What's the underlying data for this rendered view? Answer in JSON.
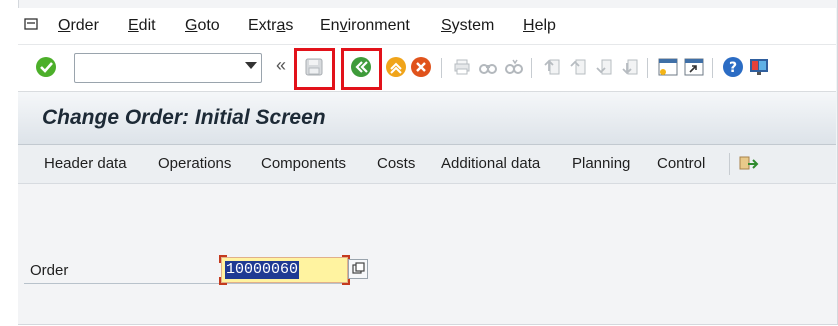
{
  "menu": {
    "items": [
      {
        "label": "Order",
        "mnemonic": "O",
        "rest": "rder"
      },
      {
        "label": "Edit",
        "mnemonic": "E",
        "rest": "dit"
      },
      {
        "label": "Goto",
        "mnemonic": "G",
        "rest": "oto"
      },
      {
        "label": "Extras",
        "pre": "Extr",
        "mnemonic": "a",
        "rest": "s"
      },
      {
        "label": "Environment",
        "pre": "En",
        "mnemonic": "v",
        "rest": "ironment"
      },
      {
        "label": "System",
        "mnemonic": "S",
        "rest": "ystem"
      },
      {
        "label": "Help",
        "mnemonic": "H",
        "rest": "elp"
      }
    ]
  },
  "toolbar": {
    "command_value": "",
    "icons": [
      "enter-icon",
      "save-icon",
      "back-icon",
      "exit-icon",
      "cancel-icon",
      "print-icon",
      "find-icon",
      "find-next-icon",
      "first-page-icon",
      "previous-page-icon",
      "next-page-icon",
      "last-page-icon",
      "new-session-icon",
      "shortcut-icon",
      "help-icon",
      "layout-menu-icon"
    ],
    "highlight_color": "#e2121a"
  },
  "title": "Change Order: Initial Screen",
  "app_toolbar": {
    "buttons": [
      "Header data",
      "Operations",
      "Components",
      "Costs",
      "Additional data",
      "Planning",
      "Control"
    ]
  },
  "form": {
    "order_label": "Order",
    "order_value": "10000060"
  }
}
